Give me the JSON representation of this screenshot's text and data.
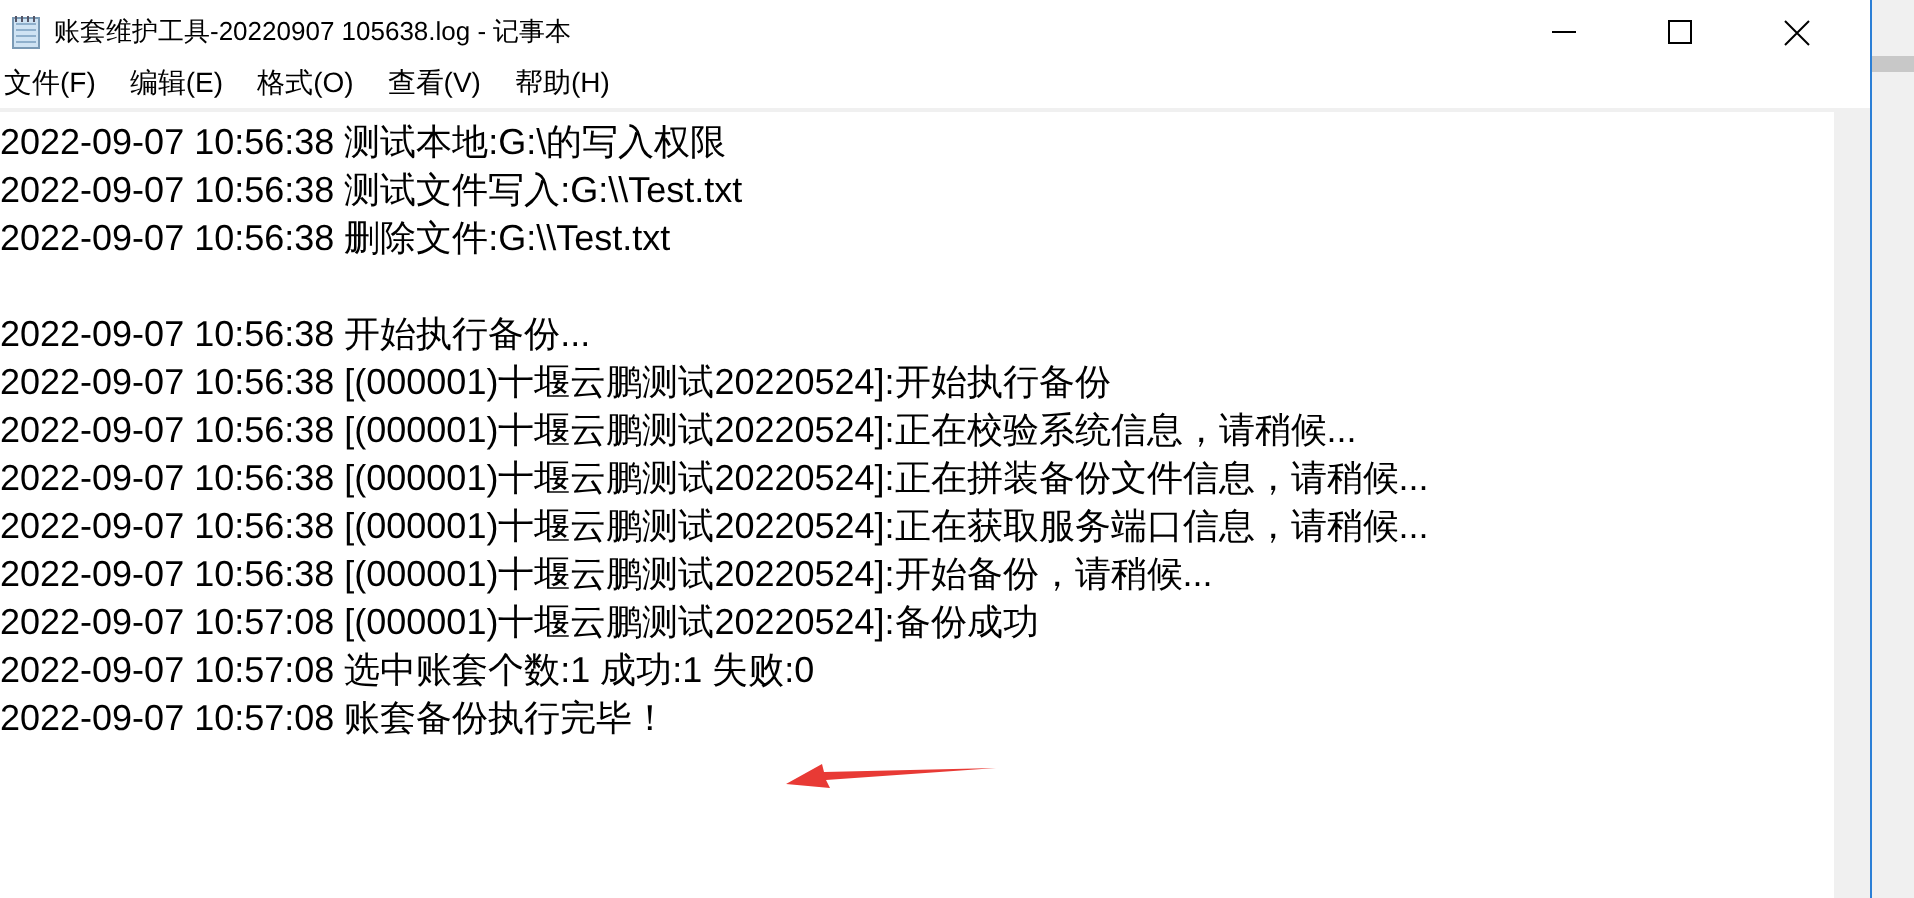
{
  "window": {
    "title": "账套维护工具-20220907 105638.log - 记事本"
  },
  "menu": [
    "文件(F)",
    "编辑(E)",
    "格式(O)",
    "查看(V)",
    "帮助(H)"
  ],
  "document": {
    "blocks": [
      [
        "2022-09-07 10:56:38 测试本地:G:\\的写入权限",
        "2022-09-07 10:56:38 测试文件写入:G:\\\\Test.txt",
        "2022-09-07 10:56:38 删除文件:G:\\\\Test.txt"
      ],
      [
        "2022-09-07 10:56:38 开始执行备份...",
        "2022-09-07 10:56:38 [(000001)十堰云鹏测试20220524]:开始执行备份",
        "2022-09-07 10:56:38 [(000001)十堰云鹏测试20220524]:正在校验系统信息，请稍候...",
        "2022-09-07 10:56:38 [(000001)十堰云鹏测试20220524]:正在拼装备份文件信息，请稍候...",
        "2022-09-07 10:56:38 [(000001)十堰云鹏测试20220524]:正在获取服务端口信息，请稍候...",
        "2022-09-07 10:56:38 [(000001)十堰云鹏测试20220524]:开始备份，请稍候...",
        "2022-09-07 10:57:08 [(000001)十堰云鹏测试20220524]:备份成功",
        "2022-09-07 10:57:08 选中账套个数:1 成功:1 失败:0",
        "2022-09-07 10:57:08 账套备份执行完毕！"
      ]
    ]
  }
}
